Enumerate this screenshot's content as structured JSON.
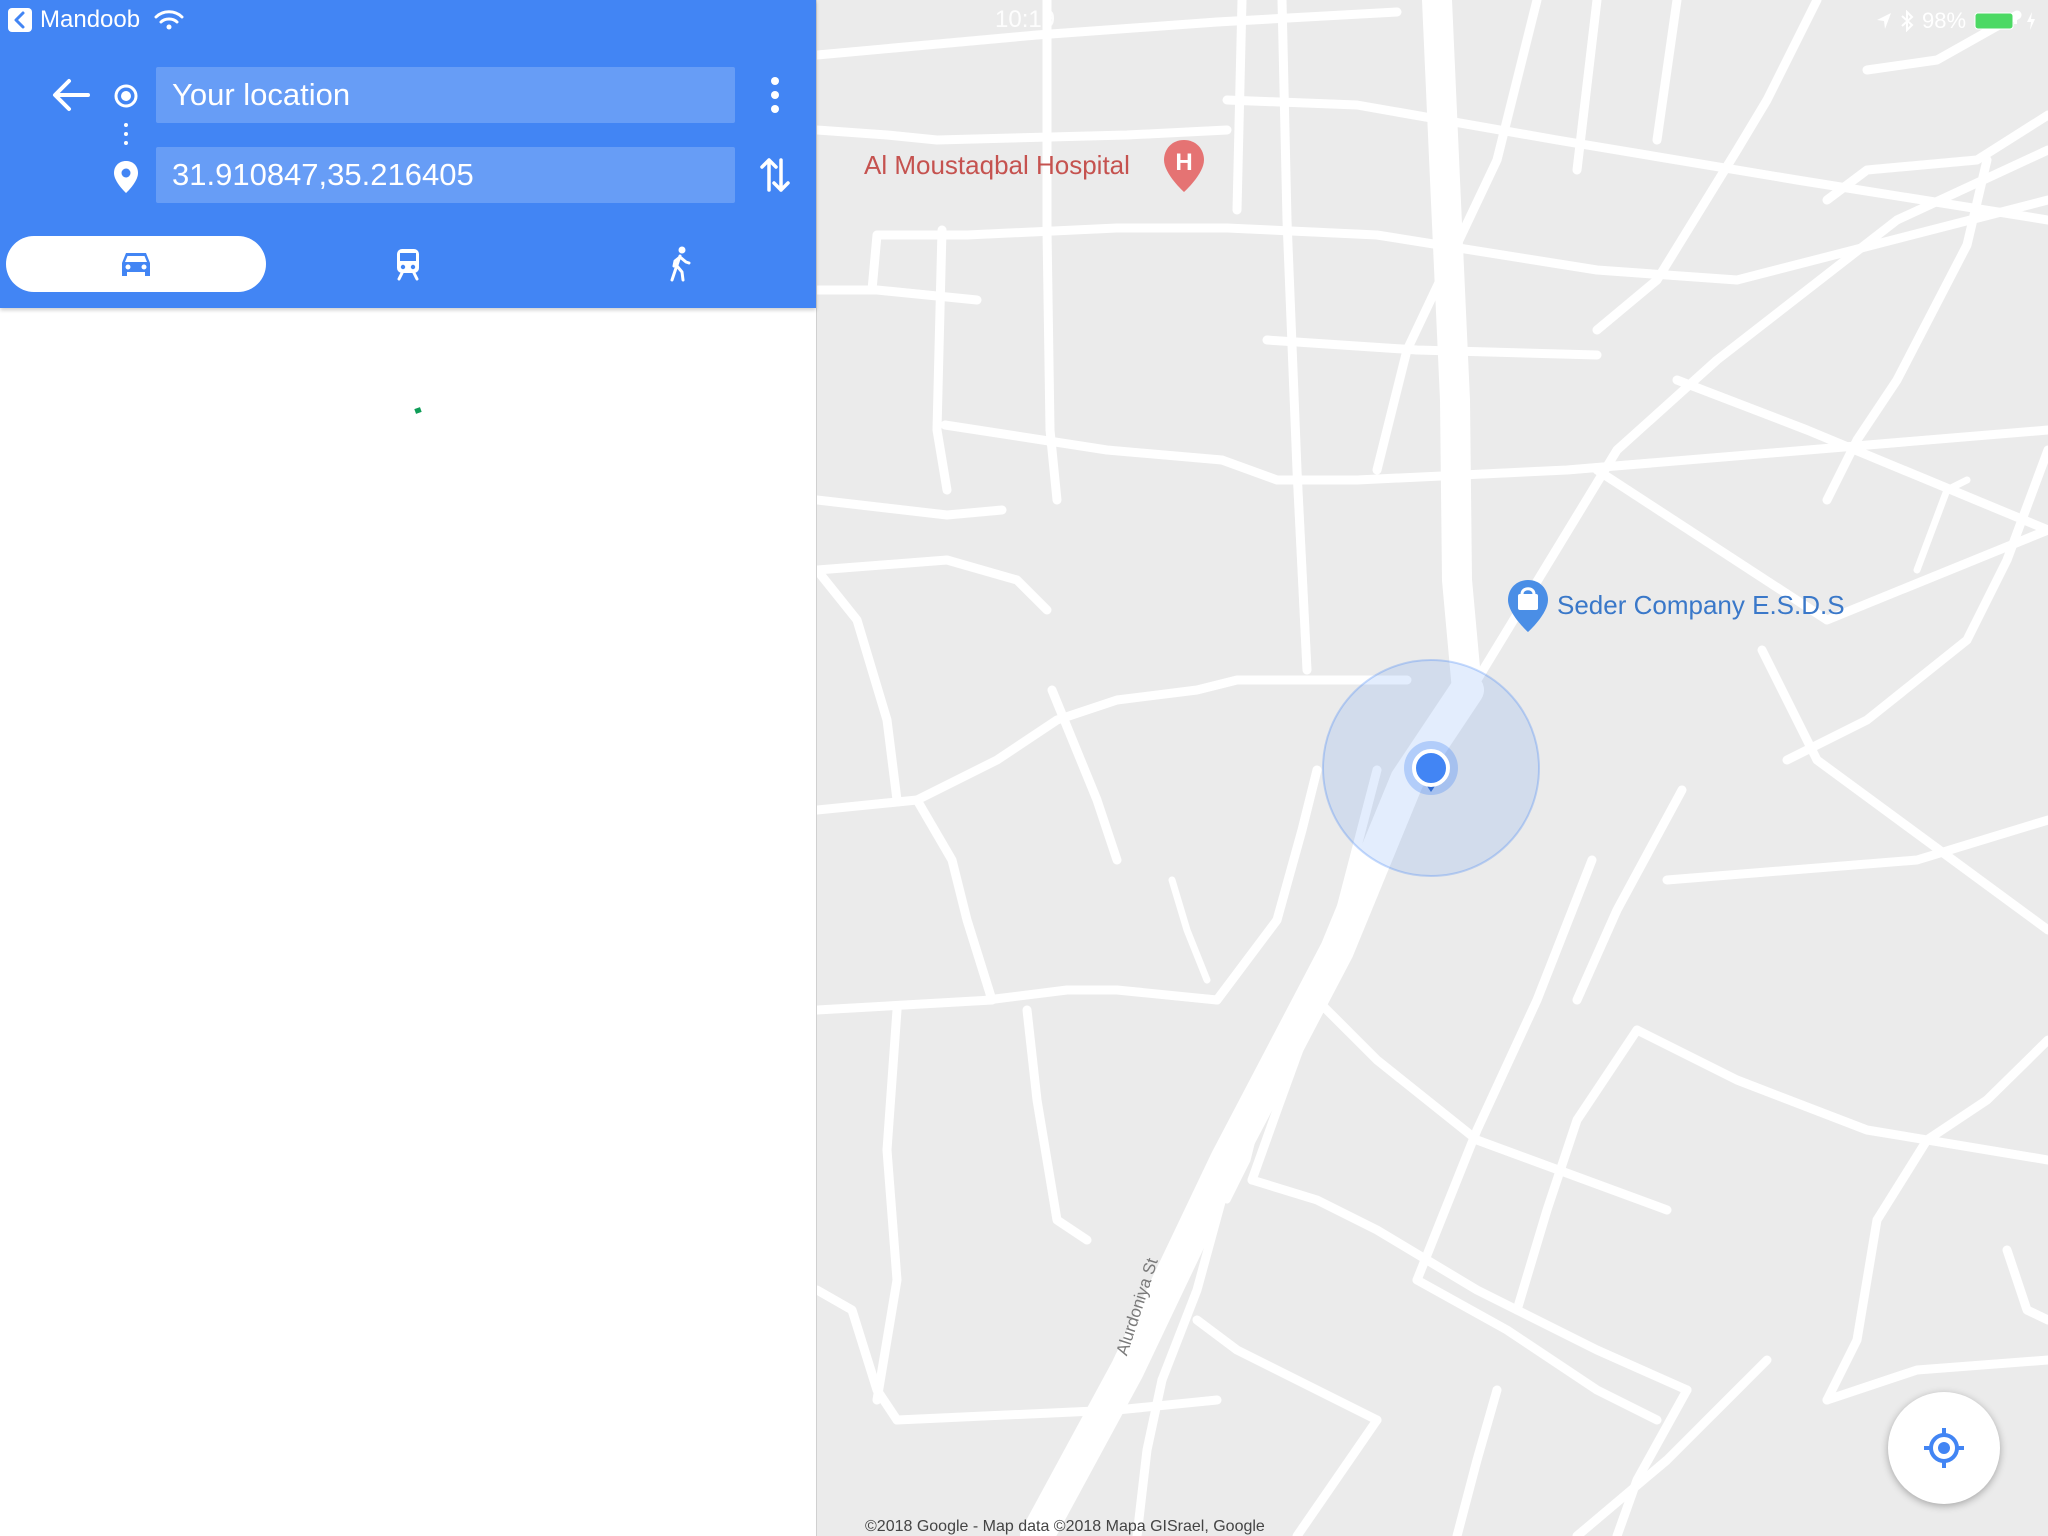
{
  "status_bar": {
    "back_app": "Mandoob",
    "time": "10:19",
    "battery": "98"
  },
  "directions": {
    "origin": "Your location",
    "destination": "31.910847,35.216405"
  },
  "travel_modes": [
    {
      "mode": "driving",
      "icon": "car-icon",
      "active": true
    },
    {
      "mode": "transit",
      "icon": "train-icon",
      "active": false
    },
    {
      "mode": "walking",
      "icon": "walk-icon",
      "active": false
    }
  ],
  "map": {
    "pois": [
      {
        "name": "Al Moustaqbal Hospital",
        "icon": "hospital-pin-icon",
        "color": "#c5524f"
      },
      {
        "name": "Seder Company E.S.D.S",
        "icon": "shopping-pin-icon",
        "color": "#3a78c9"
      }
    ],
    "streets": [
      {
        "name": "Alurdoniya St"
      }
    ],
    "copyright": "©2018 Google - Map data ©2018 Mapa GISrael, Google"
  },
  "colors": {
    "header": "#4285f4",
    "map_background": "#ebebeb",
    "road": "#ffffff",
    "location_dot": "#4285f4"
  }
}
